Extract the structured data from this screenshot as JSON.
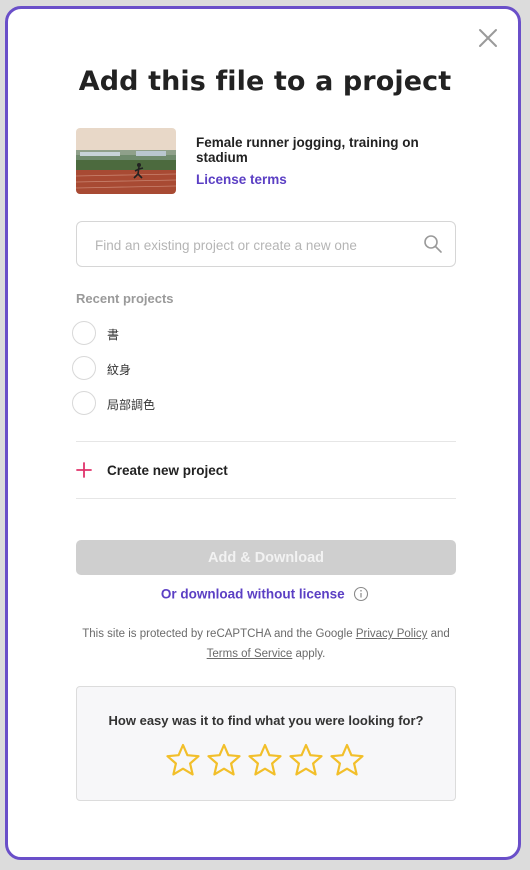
{
  "dialog": {
    "title": "Add this file to a project",
    "file": {
      "title": "Female runner jogging, training on stadium",
      "license_link": "License terms"
    },
    "search": {
      "placeholder": "Find an existing project or create a new one",
      "value": ""
    },
    "recent_projects_label": "Recent projects",
    "recent_projects": [
      {
        "name": "書"
      },
      {
        "name": "紋身"
      },
      {
        "name": "局部調色"
      }
    ],
    "create_project_label": "Create new project",
    "add_download_label": "Add & Download",
    "no_license_link": "Or download without license",
    "recaptcha": {
      "prefix": "This site is protected by reCAPTCHA and the Google",
      "privacy_link": "Privacy Policy",
      "and": "and",
      "terms_link": "Terms of Service",
      "suffix": "apply."
    },
    "feedback": {
      "question": "How easy was it to find what you were looking for?",
      "stars_total": 5,
      "stars_selected": 0
    }
  },
  "colors": {
    "accent": "#5b3fc4",
    "border": "#6a4fc9",
    "plus": "#e0336b",
    "star": "#f2bf2a",
    "button_disabled": "#cfcfcf"
  },
  "icons": [
    "close-icon",
    "search-icon",
    "plus-icon",
    "info-icon",
    "star-icon"
  ]
}
